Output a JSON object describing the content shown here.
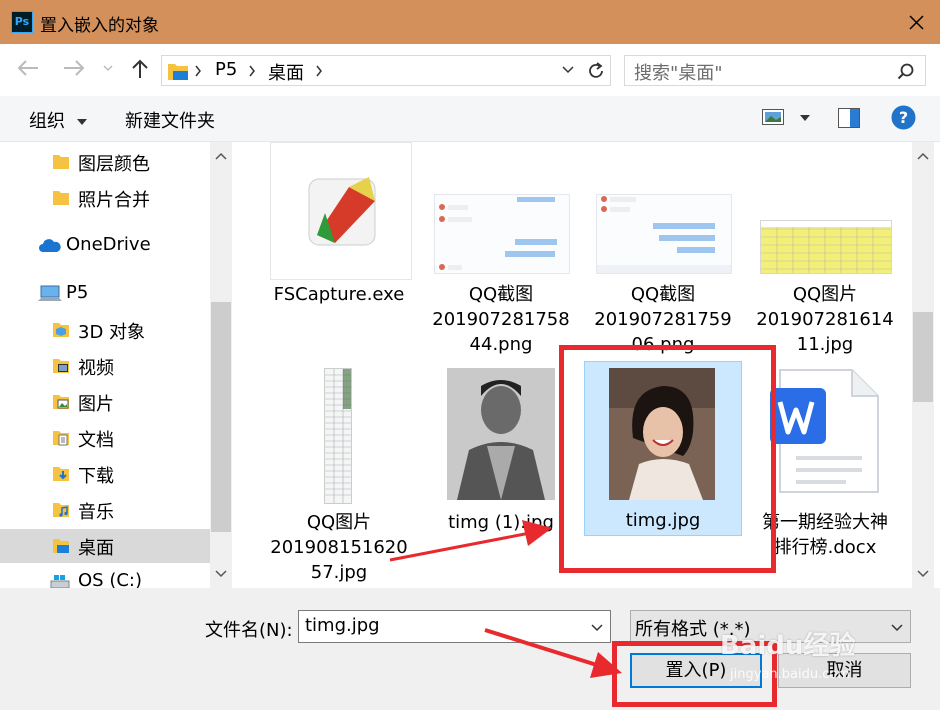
{
  "window": {
    "title": "置入嵌入的对象",
    "app_icon_text": "Ps"
  },
  "address": {
    "crumbs": [
      "P5",
      "桌面"
    ],
    "search_placeholder": "搜索\"桌面\""
  },
  "toolbar": {
    "organize": "组织",
    "new_folder": "新建文件夹"
  },
  "sidebar": {
    "items": [
      {
        "label": "图层颜色",
        "icon": "folder-icon"
      },
      {
        "label": "照片合并",
        "icon": "folder-icon"
      },
      {
        "label": "OneDrive",
        "icon": "cloud-icon"
      },
      {
        "label": "P5",
        "icon": "computer-icon"
      },
      {
        "label": "3D 对象",
        "icon": "3d-objects-icon"
      },
      {
        "label": "视频",
        "icon": "video-folder-icon"
      },
      {
        "label": "图片",
        "icon": "pictures-folder-icon"
      },
      {
        "label": "文档",
        "icon": "documents-folder-icon"
      },
      {
        "label": "下载",
        "icon": "downloads-folder-icon"
      },
      {
        "label": "音乐",
        "icon": "music-folder-icon"
      },
      {
        "label": "桌面",
        "icon": "desktop-folder-icon"
      },
      {
        "label": "OS (C:)",
        "icon": "drive-icon"
      }
    ]
  },
  "files": [
    {
      "name_lines": [
        "FSCapture.exe"
      ],
      "icon": "fscapture-icon"
    },
    {
      "name_lines": [
        "QQ截图",
        "201907281758",
        "44.png"
      ],
      "icon": "chat-screenshot-thumb"
    },
    {
      "name_lines": [
        "QQ截图",
        "201907281759",
        "06.png"
      ],
      "icon": "chat-screenshot-thumb"
    },
    {
      "name_lines": [
        "QQ图片",
        "201907281614",
        "11.jpg"
      ],
      "icon": "spreadsheet-thumb"
    },
    {
      "name_lines": [
        "QQ图片",
        "201908151620",
        "57.jpg"
      ],
      "icon": "long-spreadsheet-thumb"
    },
    {
      "name_lines": [
        "timg (1).jpg"
      ],
      "icon": "photo-man-thumb"
    },
    {
      "name_lines": [
        "timg.jpg"
      ],
      "icon": "photo-woman-thumb"
    },
    {
      "name_lines": [
        "第一期经验大神",
        "排行榜.docx"
      ],
      "icon": "wps-doc-icon"
    }
  ],
  "bottom": {
    "filename_label": "文件名(N):",
    "filename_value": "timg.jpg",
    "filetype_value": "所有格式 (*.*)",
    "place_button": "置入(P)",
    "cancel_button": "取消"
  },
  "watermark": {
    "text": "Baidu经验",
    "sub": "jingyan.baidu.com"
  },
  "colors": {
    "titlebar": "#d4905a",
    "selection": "#cce8ff",
    "annotation": "#e8292e",
    "accent": "#0078d7"
  }
}
